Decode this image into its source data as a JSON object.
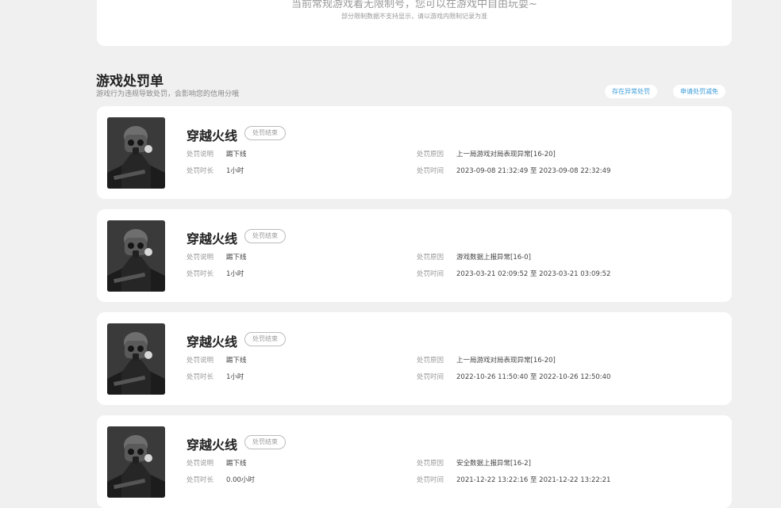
{
  "top": {
    "line1": "当前常规游戏着无限制号，您可以在游戏中自由玩耍~",
    "line2": "部分限制数据不支持显示，请以游戏内限制记录为准"
  },
  "section": {
    "title": "游戏处罚单",
    "subtitle": "游戏行为违规导致处罚，会影响您的信用分哦",
    "btn_abnormal": "存在异常处罚",
    "btn_appeal": "申请处罚减免"
  },
  "labels": {
    "desc": "处罚说明",
    "duration": "处罚时长",
    "reason": "处罚原因",
    "time": "处罚时间"
  },
  "cards": [
    {
      "game": "穿越火线",
      "status": "处罚结束",
      "desc": "踢下线",
      "duration": "1小时",
      "reason": "上一局游戏对局表现异常[16-20]",
      "time": "2023-09-08 21:32:49 至 2023-09-08 22:32:49"
    },
    {
      "game": "穿越火线",
      "status": "处罚结束",
      "desc": "踢下线",
      "duration": "1小时",
      "reason": "游戏数据上报异常[16-0]",
      "time": "2023-03-21 02:09:52 至 2023-03-21 03:09:52"
    },
    {
      "game": "穿越火线",
      "status": "处罚结束",
      "desc": "踢下线",
      "duration": "1小时",
      "reason": "上一局游戏对局表现异常[16-20]",
      "time": "2022-10-26 11:50:40 至 2022-10-26 12:50:40"
    },
    {
      "game": "穿越火线",
      "status": "处罚结束",
      "desc": "踢下线",
      "duration": "0.00小时",
      "reason": "安全数据上报异常[16-2]",
      "time": "2021-12-22 13:22:16 至 2021-12-22 13:22:21"
    }
  ]
}
